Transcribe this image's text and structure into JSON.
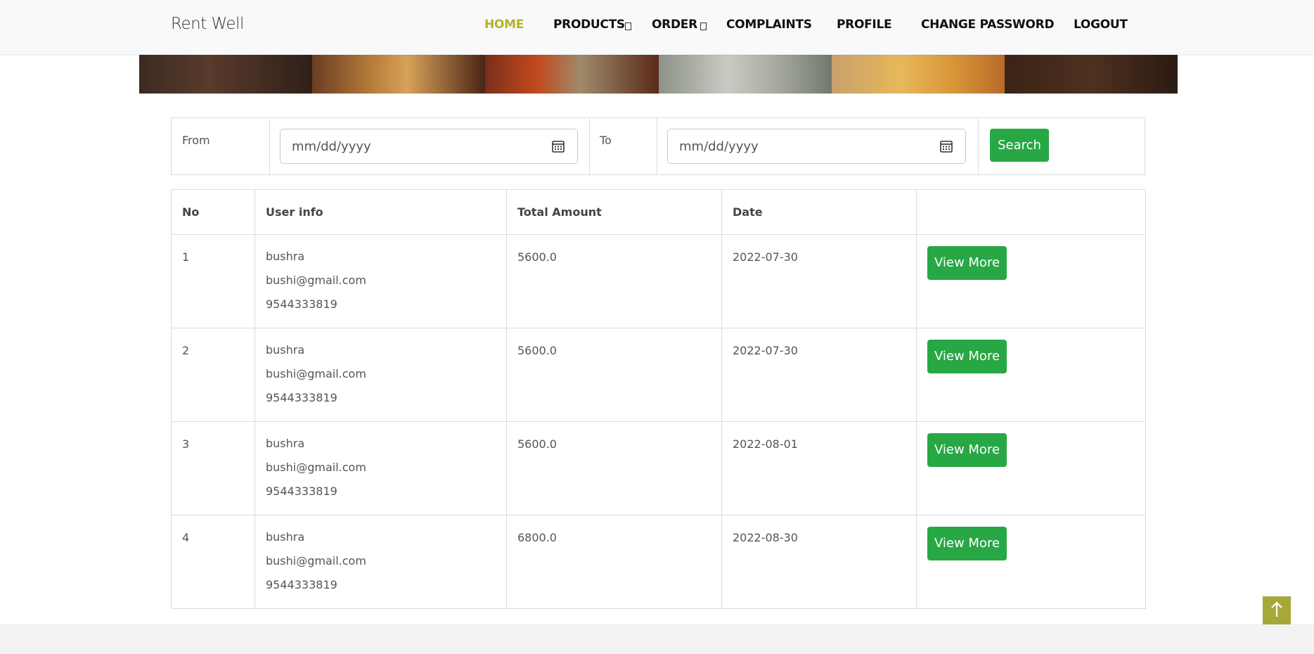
{
  "brand": "Rent Well",
  "nav": {
    "home": "HOME",
    "products": "PRODUCTS",
    "order": "ORDER",
    "complaints": "COMPLAINTS",
    "profile": "PROFILE",
    "change_password": "CHANGE PASSWORD",
    "logout": "LOGOUT"
  },
  "filter": {
    "from_label": "From",
    "to_label": "To",
    "from_placeholder": "mm/dd/yyyy",
    "to_placeholder": "mm/dd/yyyy",
    "search_label": "Search"
  },
  "table": {
    "headers": [
      "No",
      "User info",
      "Total Amount",
      "Date",
      ""
    ],
    "rows": [
      {
        "no": "1",
        "name": "bushra",
        "email": "bushi@gmail.com",
        "phone": "9544333819",
        "amount": "5600.0",
        "date": "2022-07-30",
        "action": "View More"
      },
      {
        "no": "2",
        "name": "bushra",
        "email": "bushi@gmail.com",
        "phone": "9544333819",
        "amount": "5600.0",
        "date": "2022-07-30",
        "action": "View More"
      },
      {
        "no": "3",
        "name": "bushra",
        "email": "bushi@gmail.com",
        "phone": "9544333819",
        "amount": "5600.0",
        "date": "2022-08-01",
        "action": "View More"
      },
      {
        "no": "4",
        "name": "bushra",
        "email": "bushi@gmail.com",
        "phone": "9544333819",
        "amount": "6800.0",
        "date": "2022-08-30",
        "action": "View More"
      }
    ]
  },
  "colors": {
    "accent_nav": "#b3b22e",
    "button_green": "#28a745",
    "scroll_top": "#a6a838"
  },
  "icons": {
    "calendar": "calendar-icon",
    "scroll_top": "arrow-up-icon",
    "dropdown": "dropdown-caret-icon"
  }
}
